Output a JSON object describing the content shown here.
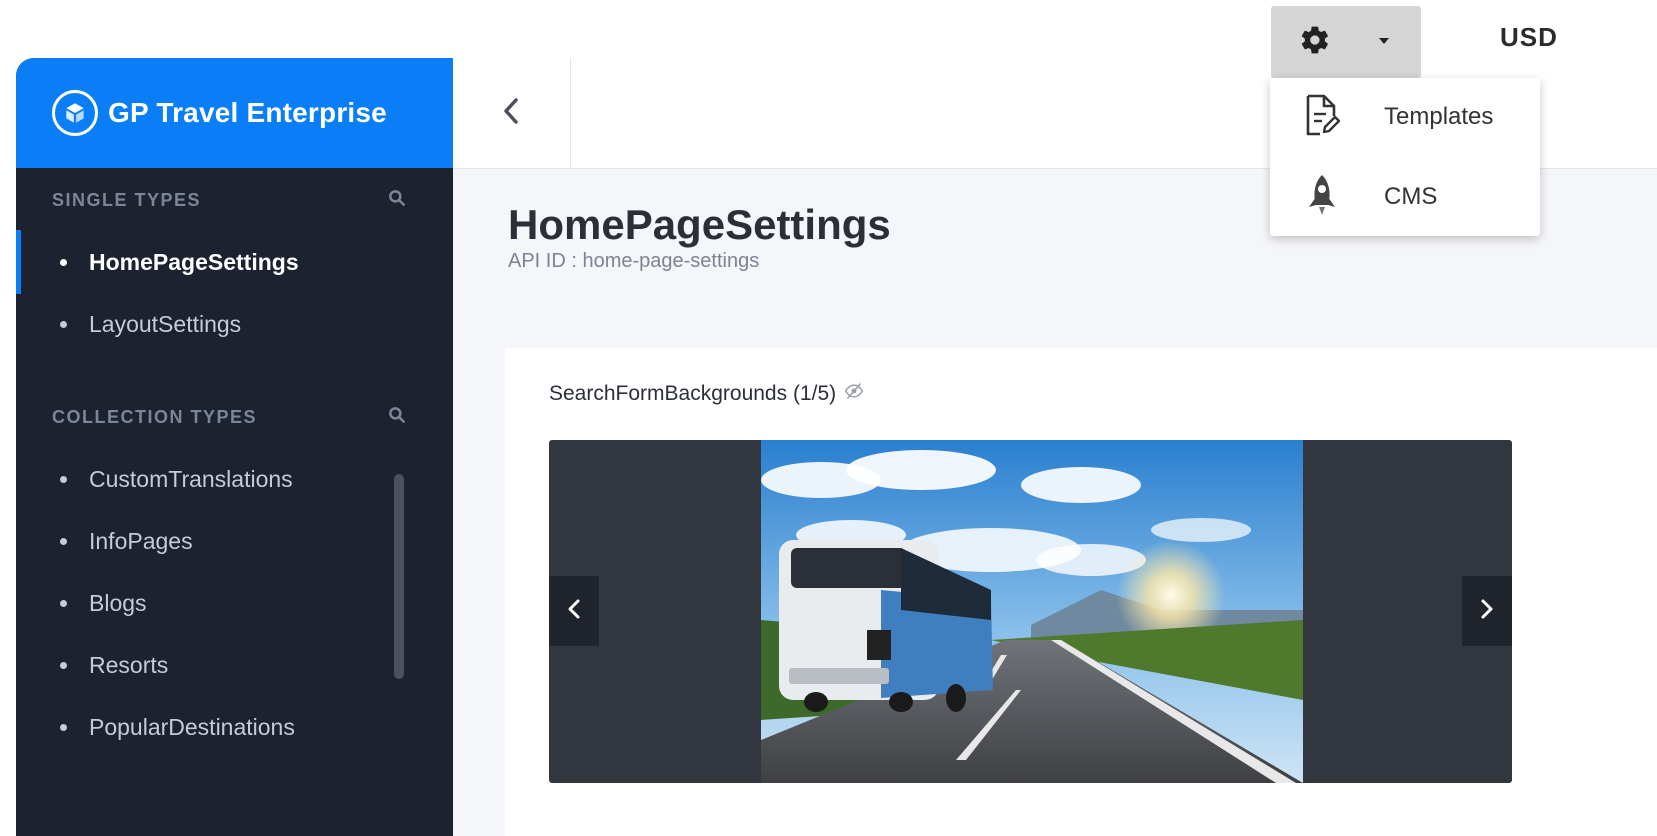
{
  "sidebar": {
    "brand_title": "GP Travel Enterprise",
    "single_types_title": "SINGLE TYPES",
    "single_types": [
      {
        "label": "HomePageSettings",
        "active": true
      },
      {
        "label": "LayoutSettings",
        "active": false
      }
    ],
    "collection_types_title": "COLLECTION TYPES",
    "collection_types": [
      {
        "label": "CustomTranslations"
      },
      {
        "label": "InfoPages"
      },
      {
        "label": "Blogs"
      },
      {
        "label": "Resorts"
      },
      {
        "label": "PopularDestinations"
      }
    ]
  },
  "main": {
    "page_title": "HomePageSettings",
    "api_id": "API ID : home-page-settings",
    "field_label": "SearchFormBackgrounds (1/5)",
    "carousel": {
      "current": 1,
      "total": 5
    }
  },
  "header": {
    "currency": "USD",
    "menu": [
      {
        "label": "Templates",
        "icon": "file-edit-icon"
      },
      {
        "label": "CMS",
        "icon": "rocket-icon"
      }
    ]
  },
  "colors": {
    "brand_blue": "#0a7ef6",
    "sidebar_bg": "#1c2230"
  }
}
